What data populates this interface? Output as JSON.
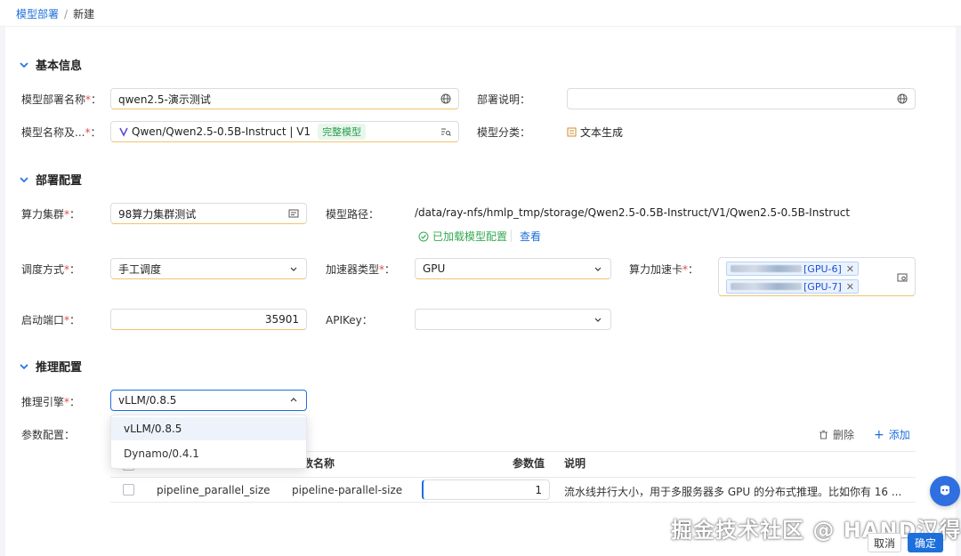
{
  "breadcrumb": {
    "parent": "模型部署",
    "separator": "/",
    "current": "新建"
  },
  "sections": {
    "basic": "基本信息",
    "deploy": "部署配置",
    "inference": "推理配置"
  },
  "basic": {
    "name_label": "模型部署名称",
    "name_value": "qwen2.5-演示测试",
    "desc_label": "部署说明",
    "desc_value": "",
    "model_label": "模型名称及...",
    "model_value": "Qwen/Qwen2.5-0.5B-Instruct | V1",
    "model_tag": "完整模型",
    "category_label": "模型分类",
    "category_value": "文本生成"
  },
  "deploy": {
    "cluster_label": "算力集群",
    "cluster_value": "98算力集群测试",
    "path_label": "模型路径",
    "path_value": "/data/ray-nfs/hmlp_tmp/storage/Qwen2.5-0.5B-Instruct/V1/Qwen2.5-0.5B-Instruct",
    "loaded_text": "已加载模型配置",
    "view_link": "查看",
    "schedule_label": "调度方式",
    "schedule_value": "手工调度",
    "accel_type_label": "加速器类型",
    "accel_type_value": "GPU",
    "accel_card_label": "算力加速卡",
    "accel_cards": [
      {
        "suffix": "[GPU-6]"
      },
      {
        "suffix": "[GPU-7]"
      }
    ],
    "port_label": "启动端口",
    "port_value": "35901",
    "apikey_label": "APIKey",
    "apikey_value": ""
  },
  "inference": {
    "engine_label": "推理引擎",
    "engine_value": "vLLM/0.8.5",
    "engine_options": [
      "vLLM/0.8.5",
      "Dynamo/0.4.1"
    ],
    "params_label": "参数配置",
    "delete_label": "删除",
    "add_label": "添加",
    "columns": {
      "name": "数名称",
      "value": "参数值",
      "desc": "说明"
    },
    "rows": [
      {
        "key": "pipeline_parallel_size",
        "name": "pipeline-parallel-size",
        "value": "1",
        "desc": "流水线并行大小，用于多服务器多 GPU 的分布式推理。比如你有 16 ..."
      }
    ]
  },
  "footer": {
    "cancel": "取消",
    "ok": "确定"
  },
  "watermark": "掘金技术社区 @ HAND汉得",
  "colors": {
    "primary": "#1d6fdc",
    "required": "#e5484d",
    "success": "#2e9d4f"
  }
}
